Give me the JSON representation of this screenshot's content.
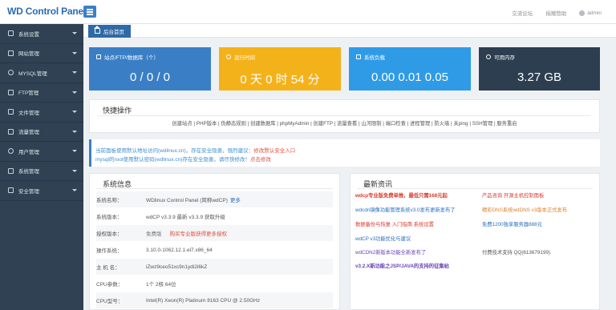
{
  "topbar": {
    "brand": "WD Control Panel",
    "links": [
      "交流论坛",
      "捐赠赞助"
    ],
    "user": "admin"
  },
  "sidebar": {
    "items": [
      {
        "label": "系统设置"
      },
      {
        "label": "网站管理"
      },
      {
        "label": "MYSQL管理"
      },
      {
        "label": "FTP管理"
      },
      {
        "label": "文件管理"
      },
      {
        "label": "流量管理"
      },
      {
        "label": "用户管理"
      },
      {
        "label": "系统管理"
      },
      {
        "label": "安全管理"
      }
    ]
  },
  "tabs": {
    "home": "后台首页"
  },
  "stats": [
    {
      "label": "站点/FTP/数据库（个）",
      "value": "0 / 0 / 0",
      "color": "#3a7fc6"
    },
    {
      "label": "运行时间",
      "value": "0 天 0 时 54 分",
      "color": "#f4b21a"
    },
    {
      "label": "系统负载",
      "value": "0.00 0.01 0.05",
      "color": "#2f9be6"
    },
    {
      "label": "可用内存",
      "value": "3.27 GB",
      "color": "#2c3e50"
    }
  ],
  "quick_actions": {
    "title": "快捷操作",
    "links": "创建站点 | PHP版本 | 伪静态规则 | 创建数据库 | phpMyAdmin | 创建FTP | 流量查看 | 山河限制 | 端口检查 | 进程管理 | 防火墙 | 关ping | SSH管理 | 服务重启"
  },
  "warning": {
    "line1_a": "当前面板使用默认地址访问(wdlinux.cn)，存在安全隐患，强烈建议：",
    "line1_b": "修改默认安全入口",
    "line2_a": "mysql的root使用默认密码(wdlinux.cn)存在安全隐患，请尽快修改！",
    "line2_b": "点击修改"
  },
  "sysinfo": {
    "title": "系统信息",
    "rows": [
      {
        "key": "系统名称：",
        "value": "WDlinux Control Panel (简称wdCP)",
        "extra": "更多"
      },
      {
        "key": "系统版本：",
        "value": "wdCP v3.3.9 最新 v3.3.9 获取升级"
      },
      {
        "key": "授权版本：",
        "value": "免费版",
        "extra": "购买专业版获得更多授权"
      },
      {
        "key": "操作系统：",
        "value": "3.10.0-1062.12.1.el7.x86_64"
      },
      {
        "key": "主 机 名：",
        "value": "iZwz9ceo51xc9n1ydi2i6kZ"
      },
      {
        "key": "CPU参数：",
        "value": "1个 2核 64位"
      },
      {
        "key": "CPU型号：",
        "value": "Intel(R) Xeon(R) Platinum 8163 CPU @ 2.50GHz"
      }
    ]
  },
  "news": {
    "title": "最新资讯",
    "items": [
      {
        "text": "wdcp专业版免费单推，最低只需168元起",
        "color": "#d93a2b"
      },
      {
        "text": "产品咨询 开源主机控制面板",
        "color": "#d93a2b"
      },
      {
        "text": "wdcdn镜像功能管理系统v3.0发布更新发布了",
        "color": "#2a6ebd"
      },
      {
        "text": "精彩DNS系统wdDNS v3版本正式发布",
        "color": "#d9822b"
      },
      {
        "text": "数据备份与恢复 入门指南 系统设置",
        "color": "#d93a2b"
      },
      {
        "text": "免费1200独享服务器888元",
        "color": "#2a6ebd"
      },
      {
        "text": "wdCP v3功能优化与建议",
        "color": "#2a6ebd"
      },
      {
        "text": "wdCDN2新版本功能全新发布了",
        "color": "#6a43b5"
      },
      {
        "text": "付费技术支持 QQ(613679199)",
        "color": "#555555"
      },
      {
        "text": "v3.2.X新功能之JSP/JAVA的支持的征集帖",
        "color": "#6a43b5"
      }
    ]
  }
}
